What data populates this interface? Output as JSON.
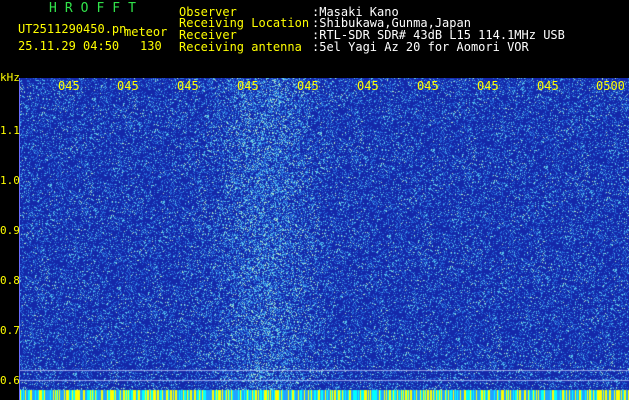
{
  "header": {
    "brand": "HROFFT",
    "file_name": "UT2511290450.pn",
    "tag": "meteor",
    "datetime": "25.11.29 04:50",
    "count": "130",
    "fields": [
      {
        "label": "Observer",
        "value": ":Masaki Kano"
      },
      {
        "label": "Receiving Location",
        "value": ":Shibukawa,Gunma,Japan"
      },
      {
        "label": "Receiver",
        "value": ":RTL-SDR SDR# 43dB L15 114.1MHz USB"
      },
      {
        "label": "Receiving antenna",
        "value": ":5el Yagi Az 20 for Aomori VOR"
      }
    ]
  },
  "spectrogram": {
    "y_unit": "kHz",
    "y_ticks": [
      "1.1",
      "1.0",
      "0.9",
      "0.8",
      "0.7",
      "0.6"
    ],
    "x_ticks": [
      "045",
      "045",
      "045",
      "045",
      "045",
      "045",
      "045",
      "045",
      "045",
      "0500"
    ],
    "colors": {
      "background": "#1a2fb5",
      "noise": "#3d8fe0",
      "text": "#ffff00",
      "brand": "#31e34a"
    }
  }
}
